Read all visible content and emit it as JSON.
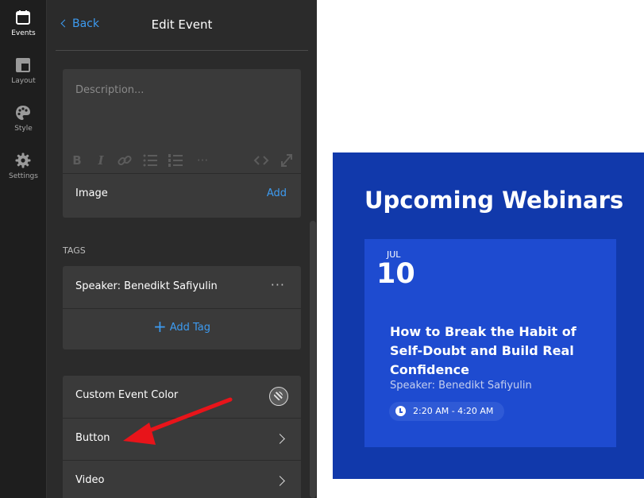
{
  "rail": {
    "items": [
      {
        "label": "Events",
        "icon": "calendar-icon"
      },
      {
        "label": "Layout",
        "icon": "layout-icon"
      },
      {
        "label": "Style",
        "icon": "palette-icon"
      },
      {
        "label": "Settings",
        "icon": "gear-icon"
      }
    ]
  },
  "panel": {
    "back_label": "Back",
    "title": "Edit Event",
    "description_placeholder": "Description...",
    "toolbar": {
      "bold": "B",
      "italic": "I",
      "more": "···"
    },
    "image": {
      "label": "Image",
      "action": "Add"
    },
    "tags_heading": "TAGS",
    "tags": [
      {
        "label": "Speaker: Benedikt Safiyulin",
        "menu": "···"
      }
    ],
    "add_tag_label": "Add Tag",
    "options": [
      {
        "label": "Custom Event Color"
      },
      {
        "label": "Button"
      },
      {
        "label": "Video"
      }
    ]
  },
  "preview": {
    "heading": "Upcoming Webinars",
    "event": {
      "month": "JUL",
      "day": "10",
      "title": "How to Break the Habit of Self-Doubt and Build Real Confidence",
      "speaker": "Speaker: Benedikt Safiyulin",
      "time": "2:20 AM - 4:20 AM"
    }
  },
  "colors": {
    "accent": "#3d9bf0",
    "panel_bg": "#2b2b2b",
    "card_bg": "#3a3a3a",
    "widget_bg": "#1139ab",
    "event_bg": "#1e4bd0",
    "arrow": "#e8141a"
  }
}
